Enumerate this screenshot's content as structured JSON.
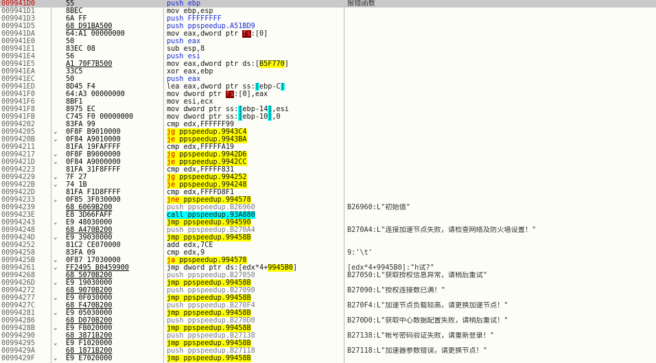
{
  "header_comment": "报错函数",
  "rows": [
    {
      "addr": "009941D0",
      "hex": "55",
      "mn": "push",
      "op": "ebp",
      "kind": "push",
      "cmt": "报错函数",
      "sel": true
    },
    {
      "addr": "009941D1",
      "hex": "8BEC",
      "mn": "mov",
      "op": "ebp,esp",
      "kind": "plain"
    },
    {
      "addr": "009941D3",
      "hex": "6A FF",
      "mn": "push",
      "op": "FFFFFFFF",
      "kind": "push"
    },
    {
      "addr": "009941D5",
      "hex": "68 D91BA500",
      "mn": "push",
      "op": "ppspeedup.A51BD9",
      "kind": "push",
      "ul": true
    },
    {
      "addr": "009941DA",
      "hex": "64:A1 00000000",
      "mn": "mov",
      "op": "eax,dword ptr |fs|:[0]",
      "kind": "segred"
    },
    {
      "addr": "009941E0",
      "hex": "50",
      "mn": "push",
      "op": "eax",
      "kind": "push"
    },
    {
      "addr": "009941E1",
      "hex": "83EC 08",
      "mn": "sub",
      "op": "esp,8",
      "kind": "plain"
    },
    {
      "addr": "009941E4",
      "hex": "56",
      "mn": "push",
      "op": "esi",
      "kind": "push"
    },
    {
      "addr": "009941E5",
      "hex": "A1 70F7B500",
      "mn": "mov",
      "op": "eax,dword ptr ds:[|B5F770|]",
      "kind": "dsyel",
      "ul": true
    },
    {
      "addr": "009941EA",
      "hex": "33C5",
      "mn": "xor",
      "op": "eax,ebp",
      "kind": "plain"
    },
    {
      "addr": "009941EC",
      "hex": "50",
      "mn": "push",
      "op": "eax",
      "kind": "push"
    },
    {
      "addr": "009941ED",
      "hex": "8D45 F4",
      "mn": "lea",
      "op": "eax,dword ptr ss:|[|ebp-C|]|",
      "kind": "sscyan"
    },
    {
      "addr": "009941F0",
      "hex": "64:A3 00000000",
      "mn": "mov",
      "op": "dword ptr |fs|:[0],eax",
      "kind": "segred"
    },
    {
      "addr": "009941F6",
      "hex": "8BF1",
      "mn": "mov",
      "op": "esi,ecx",
      "kind": "plain"
    },
    {
      "addr": "009941F8",
      "hex": "8975 EC",
      "mn": "mov",
      "op": "dword ptr ss:|[|ebp-14|]|,esi",
      "kind": "sscyan"
    },
    {
      "addr": "009941FB",
      "hex": "C745 F0 00000000",
      "mn": "mov",
      "op": "dword ptr ss:|[|ebp-10|]|,0",
      "kind": "sscyan"
    },
    {
      "addr": "00994202",
      "hex": "83FA 99",
      "mn": "cmp",
      "op": "edx,FFFFFF99",
      "kind": "plain"
    },
    {
      "addr": "00994205",
      "hex": "0F8F B9010000",
      "mn": "jg",
      "op": "ppspeedup.9943C4",
      "kind": "jcc",
      "arr": true
    },
    {
      "addr": "0099420B",
      "hex": "0F84 A9010000",
      "mn": "je",
      "op": "ppspeedup.9943BA",
      "kind": "jcc",
      "arr": true
    },
    {
      "addr": "00994211",
      "hex": "81FA 19FAFFFF",
      "mn": "cmp",
      "op": "edx,FFFFFA19",
      "kind": "plain"
    },
    {
      "addr": "00994217",
      "hex": "0F8F B9000000",
      "mn": "jg",
      "op": "ppspeedup.9942D6",
      "kind": "jcc",
      "arr": true
    },
    {
      "addr": "0099421D",
      "hex": "0F84 A9000000",
      "mn": "je",
      "op": "ppspeedup.9942CC",
      "kind": "jcc",
      "arr": true
    },
    {
      "addr": "00994223",
      "hex": "81FA 31F8FFFF",
      "mn": "cmp",
      "op": "edx,FFFFF831",
      "kind": "plain"
    },
    {
      "addr": "00994229",
      "hex": "7F 27",
      "mn": "jg",
      "op": "ppspeedup.994252",
      "kind": "jcc",
      "arr": true
    },
    {
      "addr": "0099422B",
      "hex": "74 1B",
      "mn": "je",
      "op": "ppspeedup.994248",
      "kind": "jcc",
      "arr": true
    },
    {
      "addr": "0099422D",
      "hex": "81FA F1D8FFFF",
      "mn": "cmp",
      "op": "edx,FFFFD8F1",
      "kind": "plain"
    },
    {
      "addr": "00994233",
      "hex": "0F85 3F030000",
      "mn": "jne",
      "op": "ppspeedup.994578",
      "kind": "jcc",
      "arr": true
    },
    {
      "addr": "00994239",
      "hex": "68 6069B200",
      "mn": "push",
      "op": "ppspeedup.B26960",
      "kind": "pushph",
      "ul": true,
      "cmt": "B26960:L\"初始值\""
    },
    {
      "addr": "0099423E",
      "hex": "E8 3D66FAFF",
      "mn": "call",
      "op": "ppspeedup.93A880",
      "kind": "call"
    },
    {
      "addr": "00994243",
      "hex": "E9 48030000",
      "mn": "jmp",
      "op": "ppspeedup.994590",
      "kind": "jmp",
      "arr": true
    },
    {
      "addr": "00994248",
      "hex": "68 A470B200",
      "mn": "push",
      "op": "ppspeedup.B270A4",
      "kind": "pushph",
      "ul": true,
      "cmt": "B270A4:L\"连接加速节点失败，请检查网络及防火墙设置！\""
    },
    {
      "addr": "0099424D",
      "hex": "E9 39030000",
      "mn": "jmp",
      "op": "ppspeedup.99458B",
      "kind": "jmp",
      "arr": true
    },
    {
      "addr": "00994252",
      "hex": "81C2 CE070000",
      "mn": "add",
      "op": "edx,7CE",
      "kind": "plain"
    },
    {
      "addr": "00994258",
      "hex": "83FA 09",
      "mn": "cmp",
      "op": "edx,9",
      "kind": "plain",
      "cmt": "9:'\\t'"
    },
    {
      "addr": "0099425B",
      "hex": "0F87 17030000",
      "mn": "ja",
      "op": "ppspeedup.994578",
      "kind": "jcc",
      "arr": true
    },
    {
      "addr": "00994261",
      "hex": "FF2495 B0459900",
      "mn": "jmp",
      "op": "dword ptr ds:[edx*4+|9945B0|]",
      "kind": "jmpds",
      "arr": true,
      "ul": true,
      "cmt": "[edx*4+9945B0]:\"h试?\""
    },
    {
      "addr": "00994268",
      "hex": "68 5070B200",
      "mn": "push",
      "op": "ppspeedup.B27050",
      "kind": "pushph",
      "ul": true,
      "cmt": "B27050:L\"获取授权信息异常，请稍后重试\""
    },
    {
      "addr": "0099426D",
      "hex": "E9 19030000",
      "mn": "jmp",
      "op": "ppspeedup.99458B",
      "kind": "jmp",
      "arr": true
    },
    {
      "addr": "00994272",
      "hex": "68 9070B200",
      "mn": "push",
      "op": "ppspeedup.B27090",
      "kind": "pushph",
      "ul": true,
      "cmt": "B27090:L\"授权连接数已满！\""
    },
    {
      "addr": "00994277",
      "hex": "E9 0F030000",
      "mn": "jmp",
      "op": "ppspeedup.99458B",
      "kind": "jmp",
      "arr": true
    },
    {
      "addr": "0099427C",
      "hex": "68 F470B200",
      "mn": "push",
      "op": "ppspeedup.B270F4",
      "kind": "pushph",
      "ul": true,
      "cmt": "B270F4:L\"加速节点负载较高，请更换加速节点！\""
    },
    {
      "addr": "00994281",
      "hex": "E9 05030000",
      "mn": "jmp",
      "op": "ppspeedup.99458B",
      "kind": "jmp",
      "arr": true
    },
    {
      "addr": "00994286",
      "hex": "68 D070B200",
      "mn": "push",
      "op": "ppspeedup.B270D0",
      "kind": "pushph",
      "ul": true,
      "cmt": "B270D0:L\"获取中心数据配置失败，请稍后重试！\""
    },
    {
      "addr": "0099428B",
      "hex": "E9 FB020000",
      "mn": "jmp",
      "op": "ppspeedup.99458B",
      "kind": "jmp",
      "arr": true
    },
    {
      "addr": "00994290",
      "hex": "68 3871B200",
      "mn": "push",
      "op": "ppspeedup.B27138",
      "kind": "pushph",
      "ul": true,
      "cmt": "B27138:L\"帐号密码验证失败，请重新登录！\""
    },
    {
      "addr": "00994295",
      "hex": "E9 F1020000",
      "mn": "jmp",
      "op": "ppspeedup.99458B",
      "kind": "jmp",
      "arr": true
    },
    {
      "addr": "0099429A",
      "hex": "68 1871B200",
      "mn": "push",
      "op": "ppspeedup.B27118",
      "kind": "pushph",
      "ul": true,
      "cmt": "B27118:L\"加速器参数错误，请更换节点！\""
    },
    {
      "addr": "0099429F",
      "hex": "E9 E7020000",
      "mn": "jmp",
      "op": "ppspeedup.99458B",
      "kind": "jmp",
      "arr": true
    }
  ]
}
